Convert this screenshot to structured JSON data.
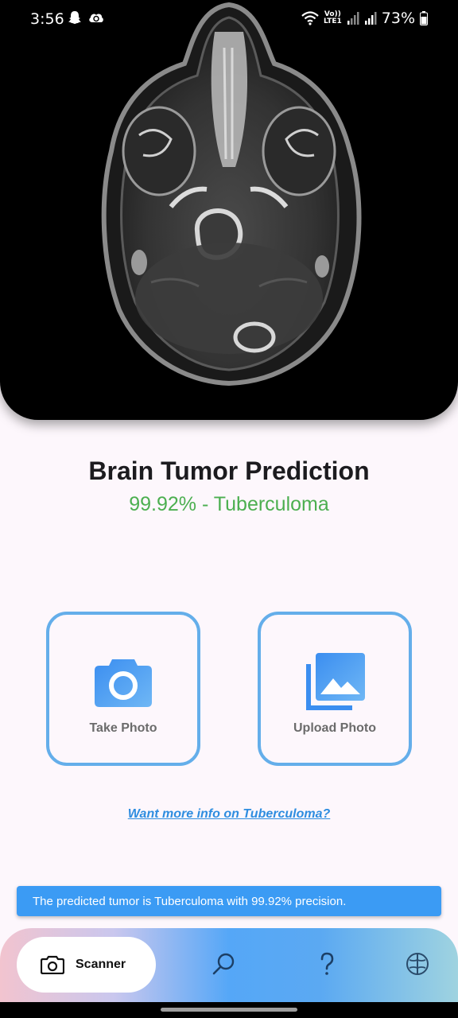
{
  "status_bar": {
    "time": "3:56",
    "volte_top": "Vo))",
    "volte_bottom": "LTE1",
    "battery": "73%"
  },
  "prediction": {
    "title": "Brain Tumor Prediction",
    "result": "99.92% - Tuberculoma",
    "result_color": "#4caf50"
  },
  "actions": {
    "take_photo": {
      "label": "Take Photo",
      "icon": "camera-icon"
    },
    "upload_photo": {
      "label": "Upload Photo",
      "icon": "photo-library-icon"
    }
  },
  "info_link": "Want more info on Tuberculoma?",
  "snackbar": "The predicted tumor is Tuberculoma with 99.92% precision.",
  "bottom_nav": {
    "scanner_label": "Scanner",
    "items": [
      {
        "icon": "camera-icon",
        "active": true
      },
      {
        "icon": "search-icon",
        "active": false
      },
      {
        "icon": "help-icon",
        "active": false
      },
      {
        "icon": "brain-icon",
        "active": false
      }
    ]
  },
  "colors": {
    "accent": "#64aeea",
    "link": "#2e8de0",
    "snackbar": "#3b9bf4"
  }
}
